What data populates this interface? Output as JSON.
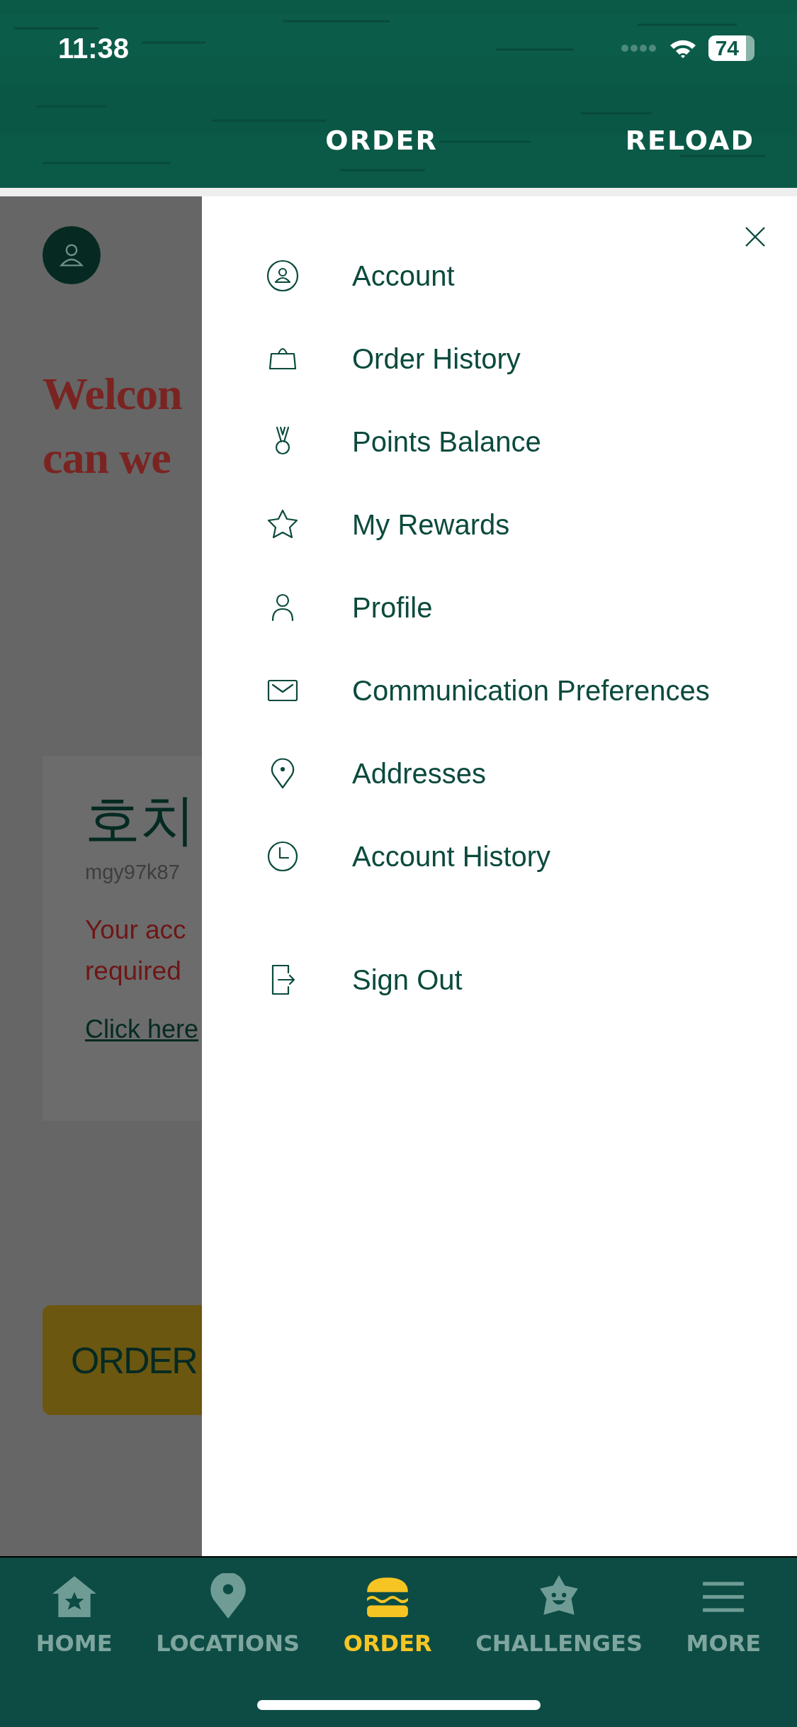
{
  "status_bar": {
    "time": "11:38",
    "battery": "74"
  },
  "header": {
    "tabs": [
      {
        "label": "ORDER"
      },
      {
        "label": "RELOAD"
      }
    ]
  },
  "background_page": {
    "welcome_lines": [
      "Welcon",
      "can we"
    ],
    "card": {
      "name": "호치",
      "username": "mgy97k87",
      "message_lines": [
        "Your acc",
        "required"
      ],
      "link": "Click here"
    },
    "order_button": "ORDER"
  },
  "menu": {
    "items": [
      {
        "label": "Account"
      },
      {
        "label": "Order History"
      },
      {
        "label": "Points Balance"
      },
      {
        "label": "My Rewards"
      },
      {
        "label": "Profile"
      },
      {
        "label": "Communication Preferences"
      },
      {
        "label": "Addresses"
      },
      {
        "label": "Account History"
      }
    ],
    "sign_out": "Sign Out"
  },
  "tab_bar": [
    {
      "label": "HOME",
      "selected": false
    },
    {
      "label": "LOCATIONS",
      "selected": false
    },
    {
      "label": "ORDER",
      "selected": true
    },
    {
      "label": "CHALLENGES",
      "selected": false
    },
    {
      "label": "MORE",
      "selected": false
    }
  ]
}
